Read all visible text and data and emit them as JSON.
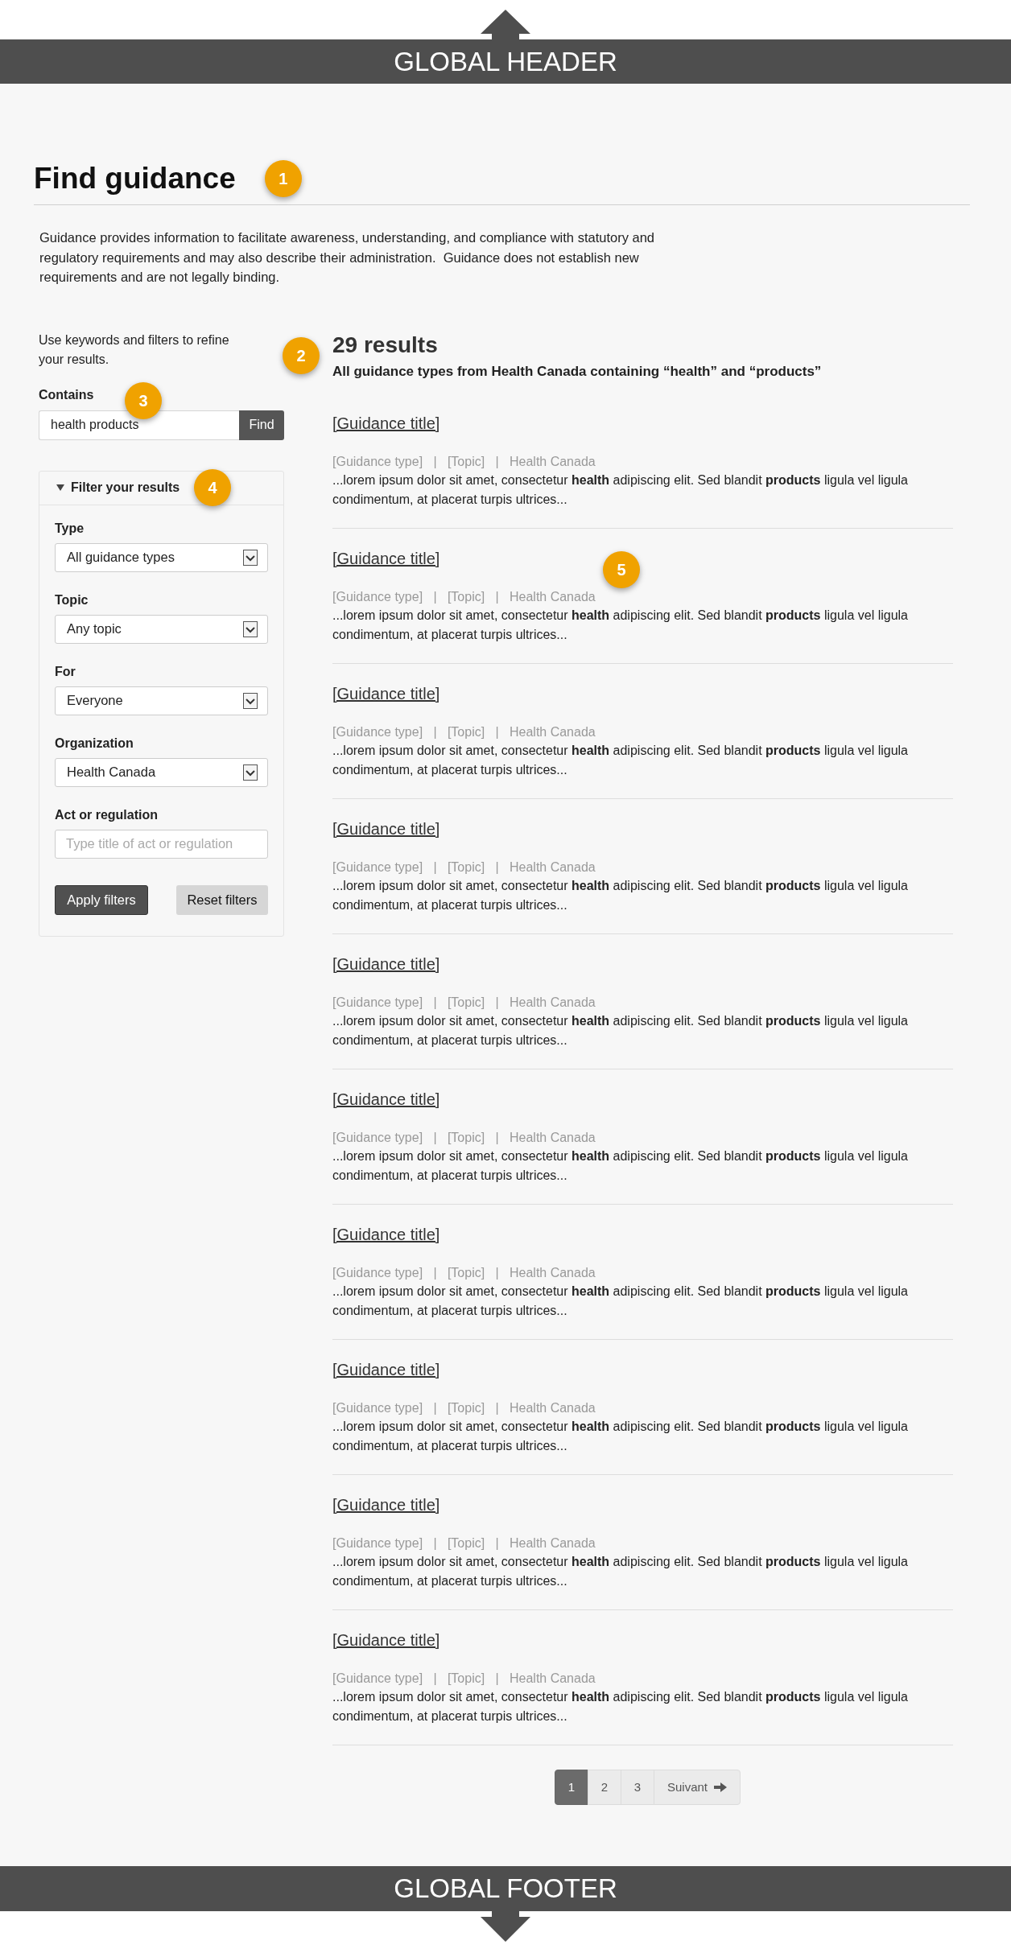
{
  "header": {
    "label": "GLOBAL HEADER"
  },
  "heading": {
    "title": "Find guidance",
    "marker": "1",
    "intro": "Guidance provides information to facilitate awareness, understanding, and compliance with statutory and regulatory requirements and may also describe their administration.  Guidance does not establish new requirements and are not legally binding."
  },
  "sidebar": {
    "hint": "Use keywords and filters to refine your results.",
    "search": {
      "label": "Contains",
      "value": "health products",
      "button": "Find",
      "marker": "3"
    },
    "filters": {
      "title": "Filter your results",
      "expanded": true,
      "marker": "4",
      "fields": [
        {
          "kind": "select",
          "label": "Type",
          "value": "All guidance types"
        },
        {
          "kind": "select",
          "label": "Topic",
          "value": "Any topic"
        },
        {
          "kind": "select",
          "label": "For",
          "value": "Everyone"
        },
        {
          "kind": "select",
          "label": "Organization",
          "value": "Health Canada"
        },
        {
          "kind": "text",
          "label": "Act or regulation",
          "placeholder": "Type title of act or regulation"
        }
      ],
      "buttons": [
        {
          "kind": "primary",
          "label": "Apply filters"
        },
        {
          "kind": "secondary",
          "label": "Reset filters"
        }
      ]
    }
  },
  "results": {
    "count": "29 results",
    "marker": "2",
    "summary": "All guidance types from Health Canada containing “health” and “products”",
    "list_marker": "5",
    "items": [
      {
        "title": "[Guidance title]",
        "meta": "[Guidance type]   |   [Topic]   |   Health Canada",
        "snippet": "...lorem ipsum dolor sit amet, consectetur **health** adipiscing elit. Sed blandit **products** ligula vel ligula condimentum, at placerat turpis ultrices..."
      },
      {
        "title": "[Guidance title]",
        "meta": "[Guidance type]   |   [Topic]   |   Health Canada",
        "snippet": "...lorem ipsum dolor sit amet, consectetur **health** adipiscing elit. Sed blandit **products** ligula vel ligula condimentum, at placerat turpis ultrices..."
      },
      {
        "title": "[Guidance title]",
        "meta": "[Guidance type]   |   [Topic]   |   Health Canada",
        "snippet": "...lorem ipsum dolor sit amet, consectetur **health** adipiscing elit. Sed blandit **products** ligula vel ligula condimentum, at placerat turpis ultrices..."
      },
      {
        "title": "[Guidance title]",
        "meta": "[Guidance type]   |   [Topic]   |   Health Canada",
        "snippet": "...lorem ipsum dolor sit amet, consectetur **health** adipiscing elit. Sed blandit **products** ligula vel ligula condimentum, at placerat turpis ultrices..."
      },
      {
        "title": "[Guidance title]",
        "meta": "[Guidance type]   |   [Topic]   |   Health Canada",
        "snippet": "...lorem ipsum dolor sit amet, consectetur **health** adipiscing elit. Sed blandit **products** ligula vel ligula condimentum, at placerat turpis ultrices..."
      },
      {
        "title": "[Guidance title]",
        "meta": "[Guidance type]   |   [Topic]   |   Health Canada",
        "snippet": "...lorem ipsum dolor sit amet, consectetur **health** adipiscing elit. Sed blandit **products** ligula vel ligula condimentum, at placerat turpis ultrices..."
      },
      {
        "title": "[Guidance title]",
        "meta": "[Guidance type]   |   [Topic]   |   Health Canada",
        "snippet": "...lorem ipsum dolor sit amet, consectetur **health** adipiscing elit. Sed blandit **products** ligula vel ligula condimentum, at placerat turpis ultrices..."
      },
      {
        "title": "[Guidance title]",
        "meta": "[Guidance type]   |   [Topic]   |   Health Canada",
        "snippet": "...lorem ipsum dolor sit amet, consectetur **health** adipiscing elit. Sed blandit **products** ligula vel ligula condimentum, at placerat turpis ultrices..."
      },
      {
        "title": "[Guidance title]",
        "meta": "[Guidance type]   |   [Topic]   |   Health Canada",
        "snippet": "...lorem ipsum dolor sit amet, consectetur **health** adipiscing elit. Sed blandit **products** ligula vel ligula condimentum, at placerat turpis ultrices..."
      },
      {
        "title": "[Guidance title]",
        "meta": "[Guidance type]   |   [Topic]   |   Health Canada",
        "snippet": "...lorem ipsum dolor sit amet, consectetur **health** adipiscing elit. Sed blandit **products** ligula vel ligula condimentum, at placerat turpis ultrices..."
      }
    ]
  },
  "pagination": {
    "pages": [
      {
        "label": "1",
        "selected": true
      },
      {
        "label": "2",
        "selected": false
      },
      {
        "label": "3",
        "selected": false
      }
    ],
    "next": "Suivant"
  },
  "footer": {
    "label": "GLOBAL FOOTER"
  }
}
